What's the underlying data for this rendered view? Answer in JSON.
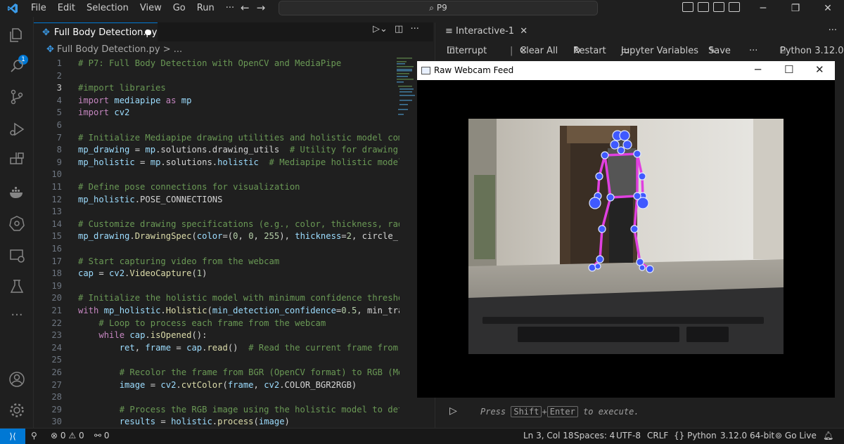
{
  "menu": [
    "File",
    "Edit",
    "Selection",
    "View",
    "Go",
    "Run",
    "···"
  ],
  "search": {
    "text": "P9"
  },
  "activity": {
    "badge": "1"
  },
  "editor": {
    "tab_label": "Full Body Detection.py",
    "breadcrumb": "Full Body Detection.py > ...",
    "lines": [
      {
        "n": "1",
        "t": "# P7: Full Body Detection with OpenCV and MediaPipe",
        "k": "com"
      },
      {
        "n": "2",
        "t": "",
        "k": "plain"
      },
      {
        "n": "3",
        "t": "#import libraries",
        "k": "com",
        "active": true
      },
      {
        "n": "4",
        "t": "import mediapipe as mp",
        "k": "import"
      },
      {
        "n": "5",
        "t": "import cv2",
        "k": "import"
      },
      {
        "n": "6",
        "t": "",
        "k": "plain"
      },
      {
        "n": "7",
        "t": "# Initialize Mediapipe drawing utilities and holistic model com",
        "k": "com"
      },
      {
        "n": "8",
        "t": "mp_drawing = mp.solutions.drawing_utils  # Utility for drawing",
        "k": "assign"
      },
      {
        "n": "9",
        "t": "mp_holistic = mp.solutions.holistic  # Mediapipe holistic model",
        "k": "assign"
      },
      {
        "n": "10",
        "t": "",
        "k": "plain"
      },
      {
        "n": "11",
        "t": "# Define pose connections for visualization",
        "k": "com"
      },
      {
        "n": "12",
        "t": "mp_holistic.POSE_CONNECTIONS",
        "k": "var"
      },
      {
        "n": "13",
        "t": "",
        "k": "plain"
      },
      {
        "n": "14",
        "t": "# Customize drawing specifications (e.g., color, thickness, rad",
        "k": "com"
      },
      {
        "n": "15",
        "t": "mp_drawing.DrawingSpec(color=(0, 0, 255), thickness=2, circle_r",
        "k": "var"
      },
      {
        "n": "16",
        "t": "",
        "k": "plain"
      },
      {
        "n": "17",
        "t": "# Start capturing video from the webcam",
        "k": "com"
      },
      {
        "n": "18",
        "t": "cap = cv2.VideoCapture(1)",
        "k": "assign"
      },
      {
        "n": "19",
        "t": "",
        "k": "plain"
      },
      {
        "n": "20",
        "t": "# Initialize the holistic model with minimum confidence thresho",
        "k": "com"
      },
      {
        "n": "21",
        "t": "with mp_holistic.Holistic(min_detection_confidence=0.5, min_tra",
        "k": "kwline"
      },
      {
        "n": "22",
        "t": "    # Loop to process each frame from the webcam",
        "k": "com"
      },
      {
        "n": "23",
        "t": "    while cap.isOpened():",
        "k": "kwline"
      },
      {
        "n": "24",
        "t": "        ret, frame = cap.read()  # Read the current frame from",
        "k": "assign"
      },
      {
        "n": "25",
        "t": "",
        "k": "plain"
      },
      {
        "n": "26",
        "t": "        # Recolor the frame from BGR (OpenCV format) to RGB (Me",
        "k": "com"
      },
      {
        "n": "27",
        "t": "        image = cv2.cvtColor(frame, cv2.COLOR_BGR2RGB)",
        "k": "assign"
      },
      {
        "n": "28",
        "t": "",
        "k": "plain"
      },
      {
        "n": "29",
        "t": "        # Process the RGB image using the holistic model to det",
        "k": "com"
      },
      {
        "n": "30",
        "t": "        results = holistic.process(image)",
        "k": "assign"
      }
    ]
  },
  "interactive": {
    "tab_label": "Interactive-1",
    "toolbar": {
      "interrupt": "Interrupt",
      "clear_all": "Clear All",
      "restart": "Restart",
      "variables": "Jupyter Variables",
      "save": "Save",
      "more": "···",
      "kernel": "Python 3.12.0"
    },
    "prompt": {
      "press": "Press",
      "shift": "Shift",
      "plus": "+",
      "enter": "Enter",
      "suffix": "to execute."
    }
  },
  "webcam": {
    "title": "Raw Webcam Feed"
  },
  "status": {
    "errors": "0",
    "warnings": "0",
    "ports": "0",
    "position": "Ln 3, Col 18",
    "spaces": "Spaces: 4",
    "encoding": "UTF-8",
    "eol": "CRLF",
    "language": "{} Python",
    "interpreter": "3.12.0 64-bit",
    "golive": "Go Live"
  },
  "colors": {
    "accent": "#0078d4",
    "skeleton": "#e040e0",
    "landmark": "#4060ff"
  }
}
